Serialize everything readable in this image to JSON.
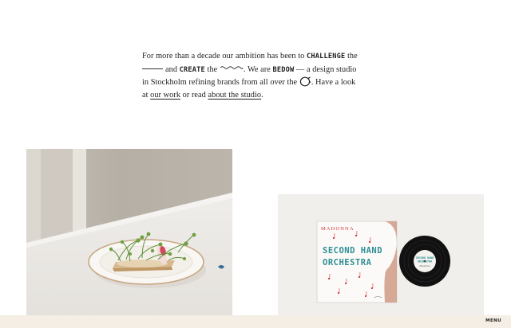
{
  "intro": {
    "line1_prefix": "For more than a decade our ambition has been to",
    "kw_challenge": "CHALLENGE",
    "line1_suffix": "the",
    "line2_and": "and",
    "kw_create": "CREATE",
    "line2_the": "the",
    "line2_we_are": ". We are",
    "kw_bedow": "BEDOW",
    "line2_suffix": "— a design studio",
    "line3_text": "in Stockholm refining brands from all over the",
    "line3_suffix": ". Have a look",
    "line4_at": "at",
    "link_our_work": "our work",
    "line4_or": "or read",
    "link_about": "about the studio",
    "line4_end": "."
  },
  "album": {
    "artist": "MADONNA",
    "title_line1": "SECOND HAND",
    "title_line2": "ORCHESTRA",
    "label_line1": "SECOND HAND",
    "label_line2": "ORCHESTRA",
    "label_line3": "Madonna"
  },
  "footer": {
    "menu_label": "MENU"
  },
  "colors": {
    "footer_bg": "#f4eee4",
    "album_teal": "#2f8f95",
    "album_red": "#d3343a"
  },
  "icons": [
    "straight-line-icon",
    "wave-line-icon",
    "globe-icon"
  ]
}
